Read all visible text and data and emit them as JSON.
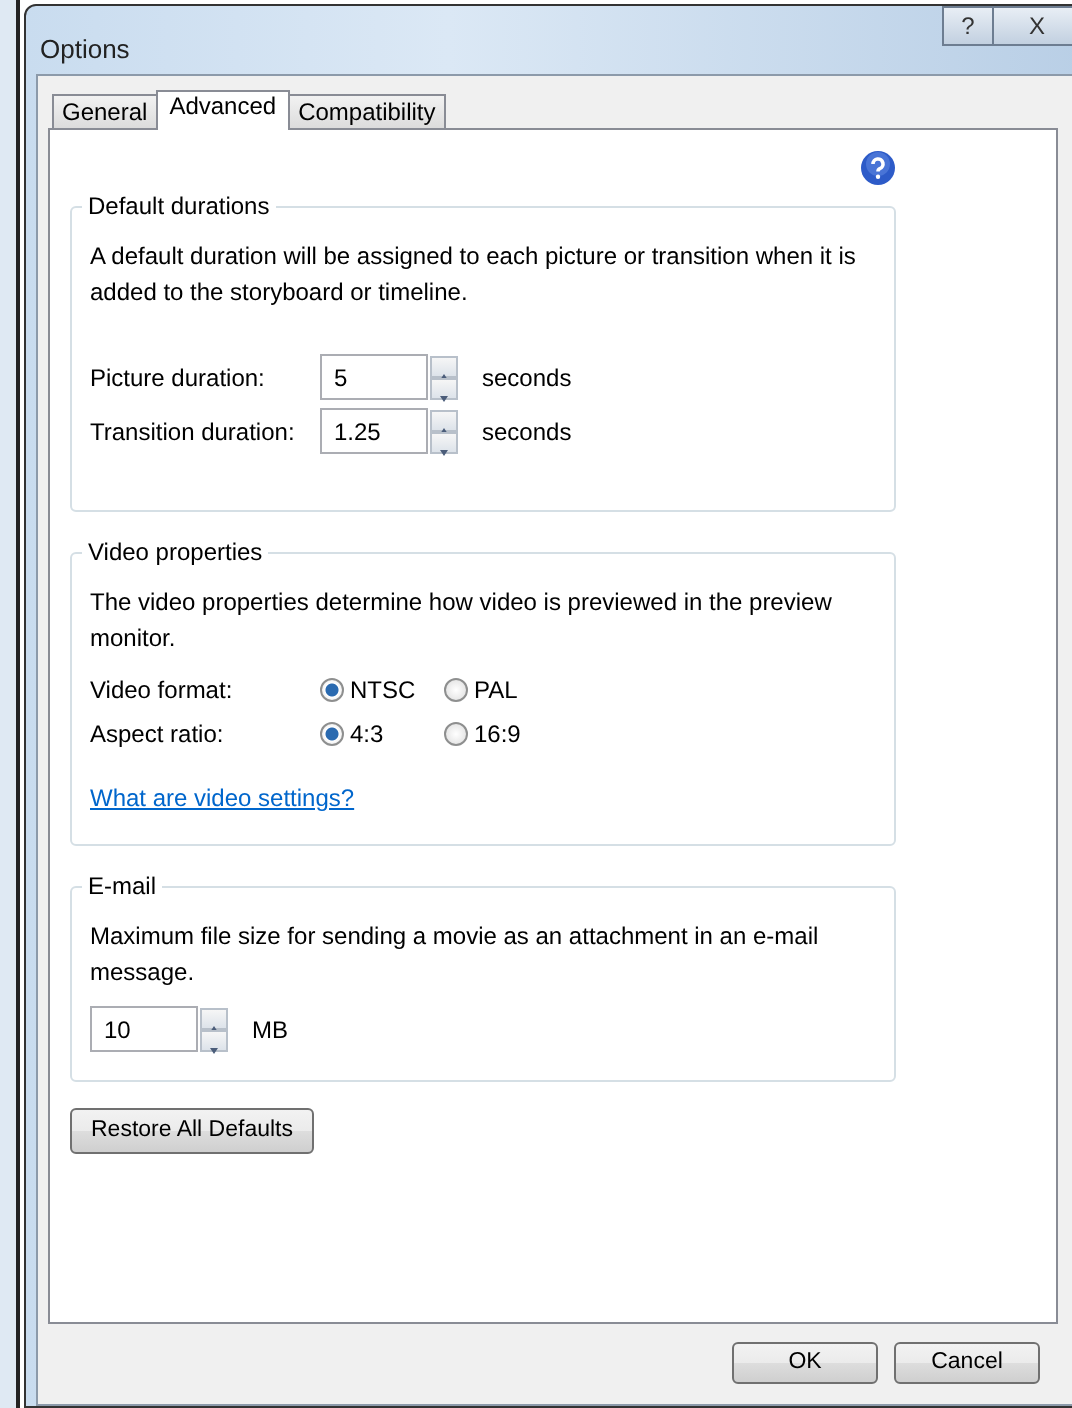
{
  "window": {
    "title": "Options",
    "title_buttons": [
      "?",
      "X"
    ]
  },
  "tabs": [
    {
      "label": "General",
      "selected": false
    },
    {
      "label": "Advanced",
      "selected": true
    },
    {
      "label": "Compatibility",
      "selected": false
    }
  ],
  "groups": [
    {
      "title": "Default durations",
      "description": "A default duration will be assigned to each picture or transition when it is added to the storyboard or timeline.",
      "rows": [
        {
          "kind": "spin",
          "label": "Picture duration:",
          "value": "5",
          "unit": "seconds"
        },
        {
          "kind": "spin",
          "label": "Transition duration:",
          "value": "1.25",
          "unit": "seconds"
        }
      ]
    },
    {
      "title": "Video properties",
      "description": "The video properties determine how video is previewed in the preview monitor.",
      "rows": [
        {
          "kind": "radio",
          "label": "Video format:",
          "options": [
            {
              "label": "NTSC",
              "selected": true
            },
            {
              "label": "PAL",
              "selected": false
            }
          ]
        },
        {
          "kind": "radio",
          "label": "Aspect ratio:",
          "options": [
            {
              "label": "4:3",
              "selected": true
            },
            {
              "label": "16:9",
              "selected": false
            }
          ]
        },
        {
          "kind": "link",
          "label": "What are video settings?"
        }
      ]
    },
    {
      "title": "E-mail",
      "description": "Maximum file size for sending a movie as an attachment in an e-mail message.",
      "rows": [
        {
          "kind": "spin",
          "value": "10",
          "unit": "MB"
        }
      ]
    }
  ],
  "restore_button": "Restore All Defaults",
  "buttons": [
    "OK",
    "Cancel"
  ]
}
